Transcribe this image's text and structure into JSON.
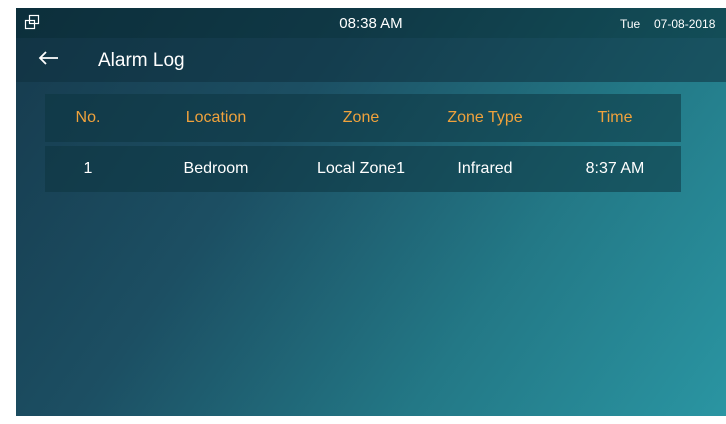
{
  "status_bar": {
    "time": "08:38 AM",
    "day": "Tue",
    "date": "07-08-2018",
    "window_icon": "window-restore-icon"
  },
  "header": {
    "back_icon": "arrow-left-icon",
    "title": "Alarm Log"
  },
  "table": {
    "columns": [
      "No.",
      "Location",
      "Zone",
      "Zone Type",
      "Time"
    ],
    "rows": [
      [
        "1",
        "Bedroom",
        "Local Zone1",
        "Infrared",
        "8:37 AM"
      ]
    ]
  },
  "colors": {
    "header_text": "#f0a23c",
    "body_text": "#ffffff",
    "background_dark": "#163a4d",
    "background_light": "#2a95a2"
  }
}
